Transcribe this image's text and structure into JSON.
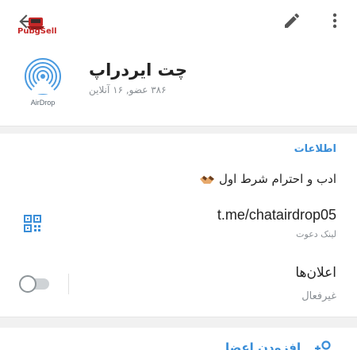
{
  "topbar": {
    "logo_text": "PubgSell",
    "back_icon": "arrow-left-icon",
    "edit_icon": "pencil-icon",
    "more_icon": "more-vertical-icon"
  },
  "header": {
    "avatar_caption": "AirDrop",
    "title": "چت ایردراپ",
    "subtitle": "۳۸۶ عضو, ۱۶ آنلاین"
  },
  "info": {
    "heading": "اطلاعات",
    "description": "ادب و احترام شرط اول",
    "link": "t.me/chatairdrop05",
    "link_caption": "لینک دعوت",
    "qr_icon": "qr-code-icon"
  },
  "notifications": {
    "label": "اعلان‌ها",
    "status": "غیرفعال",
    "enabled": false
  },
  "members": {
    "add_label": "افزودن اعضا",
    "add_icon": "add-user-icon"
  },
  "colors": {
    "accent": "#3a8ed8",
    "text": "#222222",
    "muted": "#8a8f94",
    "logo_red": "#c62828"
  }
}
